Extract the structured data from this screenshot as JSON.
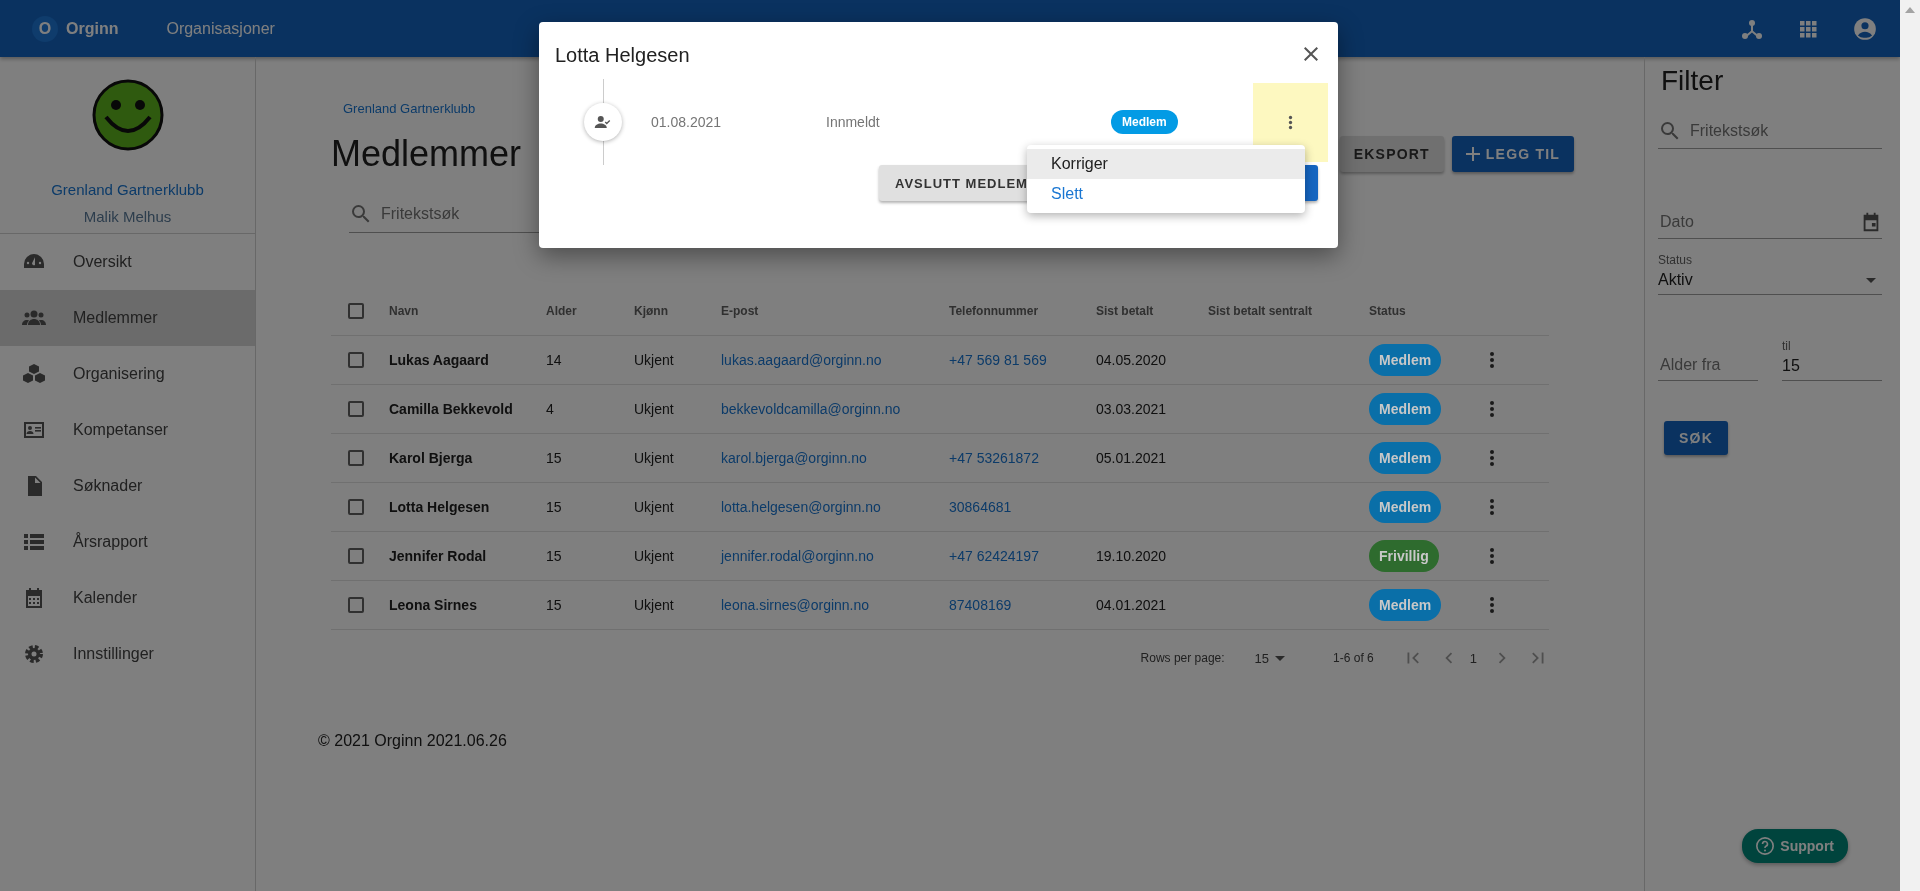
{
  "topbar": {
    "logo_letter": "O",
    "app_name": "Orginn",
    "nav": [
      "Organisasjoner"
    ]
  },
  "sidebar": {
    "org_name": "Grenland Gartnerklubb",
    "user_name": "Malik Melhus",
    "items": [
      {
        "label": "Oversikt",
        "selected": false
      },
      {
        "label": "Medlemmer",
        "selected": true
      },
      {
        "label": "Organisering",
        "selected": false
      },
      {
        "label": "Kompetanser",
        "selected": false
      },
      {
        "label": "Søknader",
        "selected": false
      },
      {
        "label": "Årsrapport",
        "selected": false
      },
      {
        "label": "Kalender",
        "selected": false
      },
      {
        "label": "Innstillinger",
        "selected": false
      }
    ]
  },
  "main": {
    "breadcrumb": "Grenland Gartnerklubb",
    "title": "Medlemmer",
    "export_button": "EKSPORT",
    "add_button": "LEGG TIL",
    "search": {
      "placeholder": "Fritekstsøk"
    },
    "table": {
      "select_all_checked": false,
      "columns": [
        "Navn",
        "Alder",
        "Kjønn",
        "E-post",
        "Telefonnummer",
        "Sist betalt",
        "Sist betalt sentralt",
        "Status"
      ],
      "rows": [
        {
          "checked": false,
          "name": "Lukas Aagaard",
          "age": "14",
          "gender": "Ukjent",
          "email": "lukas.aagaard@orginn.no",
          "phone": "+47 569 81 569",
          "last_paid": "04.05.2020",
          "status": "Medlem",
          "color": "#0a6fa8"
        },
        {
          "checked": false,
          "name": "Camilla Bekkevold",
          "age": "4",
          "gender": "Ukjent",
          "email": "bekkevoldcamilla@orginn.no",
          "last_paid": "03.03.2021",
          "status": "Medlem",
          "color": "#0a6fa8"
        },
        {
          "checked": false,
          "name": "Karol Bjerga",
          "age": "15",
          "gender": "Ukjent",
          "email": "karol.bjerga@orginn.no",
          "phone": "+47 53261872",
          "last_paid": "05.01.2021",
          "status": "Medlem",
          "color": "#0a6fa8"
        },
        {
          "checked": false,
          "name": "Lotta Helgesen",
          "age": "15",
          "gender": "Ukjent",
          "email": "lotta.helgesen@orginn.no",
          "phone": "30864681",
          "status": "Medlem",
          "color": "#0a6fa8"
        },
        {
          "checked": false,
          "name": "Jennifer Rodal",
          "age": "15",
          "gender": "Ukjent",
          "email": "jennifer.rodal@orginn.no",
          "phone": "+47 62424197",
          "last_paid": "19.10.2020",
          "status": "Frivillig",
          "color": "#2e6b2e"
        },
        {
          "checked": false,
          "name": "Leona Sirnes",
          "age": "15",
          "gender": "Ukjent",
          "email": "leona.sirnes@orginn.no",
          "phone": "87408169",
          "last_paid": "04.01.2021",
          "status": "Medlem",
          "color": "#0a6fa8"
        }
      ]
    },
    "pagination": {
      "rows_per_page_label": "Rows per page:",
      "rows_per_page": "15",
      "range": "1-6 of 6",
      "page": "1"
    },
    "footer": "© 2021 Orginn 2021.06.26"
  },
  "filter": {
    "title": "Filter",
    "search": {
      "placeholder": "Fritekstsøk"
    },
    "date": {
      "placeholder": "Dato"
    },
    "status": {
      "label": "Status",
      "value": "Aktiv"
    },
    "age_from": {
      "placeholder": "Alder fra"
    },
    "age_to": {
      "label": "til",
      "value": "15"
    },
    "search_button": "SØK"
  },
  "support_button": "Support",
  "dialog": {
    "title": "Lotta Helgesen",
    "entries": [
      {
        "date": "01.08.2021",
        "event": "Innmeldt",
        "status": "Medlem",
        "color": "#039be5"
      }
    ],
    "end_button": "AVSLUTT MEDLEM",
    "menu": [
      {
        "label": "Korriger",
        "kind": "plain",
        "selected": true
      },
      {
        "label": "Slett",
        "kind": "link",
        "selected": false
      }
    ]
  }
}
